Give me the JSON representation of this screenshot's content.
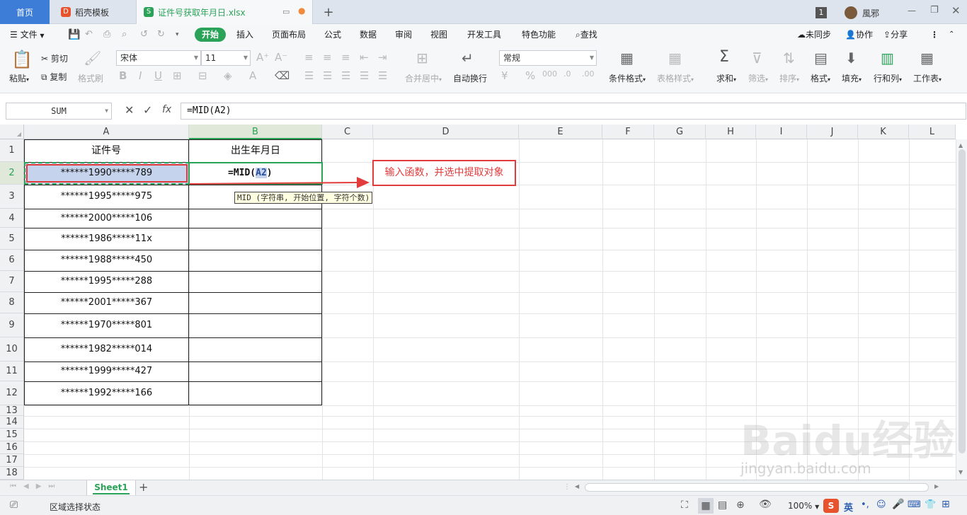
{
  "tabs": {
    "home": "首页",
    "template": "稻壳模板",
    "file": "证件号获取年月日.xlsx",
    "new_tab": "+",
    "badge": "1",
    "user": "風邪"
  },
  "menu": {
    "file": "文件",
    "items": [
      "开始",
      "插入",
      "页面布局",
      "公式",
      "数据",
      "审阅",
      "视图",
      "开发工具",
      "特色功能",
      "查找"
    ],
    "sync": "未同步",
    "collab": "协作",
    "share": "分享"
  },
  "ribbon": {
    "paste": "粘贴",
    "cut": "剪切",
    "copy": "复制",
    "format_painter": "格式刷",
    "font_name": "宋体",
    "font_size": "11",
    "merge": "合并居中",
    "wrap": "自动换行",
    "number_format": "常规",
    "cond_format": "条件格式",
    "table_style": "表格样式",
    "sum": "求和",
    "filter": "筛选",
    "sort": "排序",
    "format": "格式",
    "fill": "填充",
    "row_col": "行和列",
    "worksheet": "工作表"
  },
  "formula_bar": {
    "name_box": "SUM",
    "fx": "fx",
    "formula": "=MID(A2)"
  },
  "grid": {
    "columns": [
      "A",
      "B",
      "C",
      "D",
      "E",
      "F",
      "G",
      "H",
      "I",
      "J",
      "K",
      "L"
    ],
    "rows": [
      "1",
      "2",
      "3",
      "4",
      "5",
      "6",
      "7",
      "8",
      "9",
      "10",
      "11",
      "12",
      "13",
      "14",
      "15",
      "16",
      "17",
      "18"
    ],
    "headers": [
      "证件号",
      "出生年月日"
    ],
    "ids": [
      "******1990*****789",
      "******1995*****975",
      "******2000*****106",
      "******1986*****11x",
      "******1988*****450",
      "******1995*****288",
      "******2001*****367",
      "******1970*****801",
      "******1982*****014",
      "******1999*****427",
      "******1992*****166"
    ],
    "b2_prefix": "=MID(",
    "b2_ref": "A2",
    "b2_suffix": ")",
    "tooltip": "MID (字符串, 开始位置, 字符个数)"
  },
  "annotation": {
    "text": "输入函数，并选中提取对象",
    "color": "#e23b3b"
  },
  "sheet": {
    "name": "Sheet1",
    "add": "+"
  },
  "status": {
    "mode": "区域选择状态",
    "zoom": "100%",
    "ime": "英"
  },
  "watermark": {
    "text": "Baidu经验",
    "url": "jingyan.baidu.com"
  }
}
